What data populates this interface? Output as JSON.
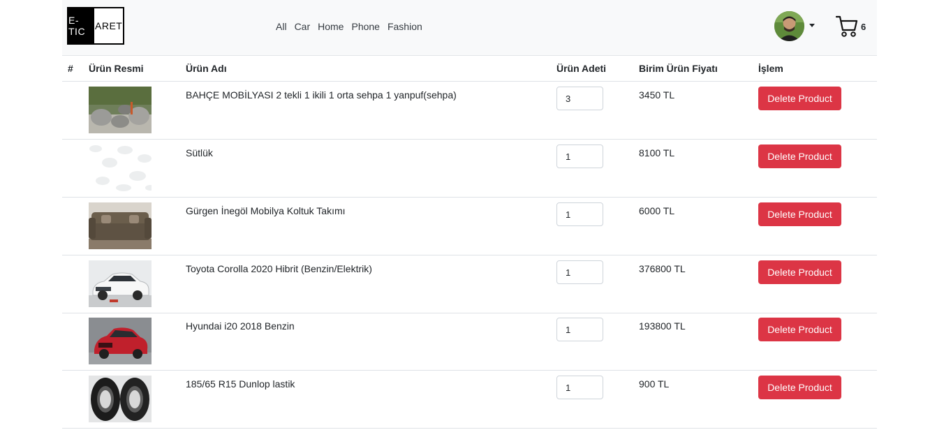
{
  "brand": {
    "left": "E-TIC",
    "right": "ARET"
  },
  "nav": {
    "links": [
      "All",
      "Car",
      "Home",
      "Phone",
      "Fashion"
    ]
  },
  "cart": {
    "count": "6"
  },
  "table": {
    "headers": {
      "index": "#",
      "image": "Ürün Resmi",
      "name": "Ürün Adı",
      "quantity": "Ürün Adeti",
      "price": "Birim Ürün Fiyatı",
      "action": "İşlem"
    },
    "delete_label": "Delete Product",
    "rows": [
      {
        "name": "BAHÇE MOBİLYASI 2 tekli 1 ikili 1 orta sehpa 1 yanpuf(sehpa)",
        "quantity": "3",
        "price": "3450 TL",
        "image": "garden-furniture-image"
      },
      {
        "name": "Sütlük",
        "quantity": "1",
        "price": "8100 TL",
        "image": "placeholder-pattern-image"
      },
      {
        "name": "Gürgen İnegöl Mobilya Koltuk Takımı",
        "quantity": "1",
        "price": "6000 TL",
        "image": "sofa-image"
      },
      {
        "name": "Toyota Corolla 2020 Hibrit (Benzin/Elektrik)",
        "quantity": "1",
        "price": "376800 TL",
        "image": "white-car-image"
      },
      {
        "name": "Hyundai i20 2018 Benzin",
        "quantity": "1",
        "price": "193800 TL",
        "image": "red-car-image"
      },
      {
        "name": "185/65 R15 Dunlop lastik",
        "quantity": "1",
        "price": "900 TL",
        "image": "tires-image"
      }
    ]
  },
  "colors": {
    "navbar_bg": "#f8f9fa",
    "danger": "#dc3545",
    "border": "#dee2e6"
  }
}
